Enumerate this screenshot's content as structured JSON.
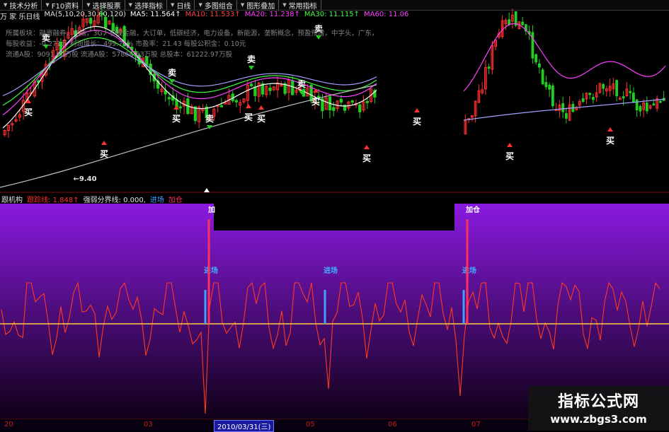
{
  "toolbar": [
    {
      "label": "技术分析"
    },
    {
      "label": "F10资料"
    },
    {
      "label": "选择股票"
    },
    {
      "label": "选择指标"
    },
    {
      "label": "日线"
    },
    {
      "label": "多图组合"
    },
    {
      "label": "图形叠加"
    },
    {
      "label": "常用指标"
    }
  ],
  "top_legend": {
    "title": "万 家 乐日线",
    "ma_def": "MA(5,10,20,30,60,120)",
    "ma5": "MA5: 11.564↑",
    "ma10": "MA10: 11.533↑",
    "ma20": "MA20: 11.238↑",
    "ma30": "MA30: 11.115↑",
    "ma60": "MA60: 11.06"
  },
  "info_lines": [
    "所属板块：融资融券，电脑，3G，参股金融，大订单，低碳经济，电力设备，新能源，垄断概念，预盈预增，中字头，广东，电器机械及器",
    "每股收益：-0.271元    利润增长：499.71%    市盈率：21.43    每股公积金：0.10元",
    "流通A股：9091.60万股    流通A股：57866.63万股    总股本：61222.97万股"
  ],
  "low_price_label": "←9.40",
  "signals": {
    "buy": "买",
    "sell": "卖",
    "enter": "进场",
    "add": "加仓"
  },
  "bottom_legend": {
    "title": "跟机构",
    "line1": "跟踪线: 1.848↑",
    "line2": "强弱分界线: 0.000,",
    "line3": "进场",
    "line4": "加仓"
  },
  "dates": {
    "labels": [
      "20",
      "03",
      "05",
      "06",
      "07"
    ],
    "selected": "2010/03/31(三)"
  },
  "watermark": {
    "title": "指标公式网",
    "url": "www.zbgs3.com"
  },
  "colors": {
    "up": "#ff3030",
    "down": "#20d020",
    "panel_top": "#8a1ae0",
    "panel_bottom": "#100018",
    "osc": "#ff3a1e",
    "baseline": "#ffd040",
    "enter": "#40a0ff",
    "add": "#ff3060"
  }
}
